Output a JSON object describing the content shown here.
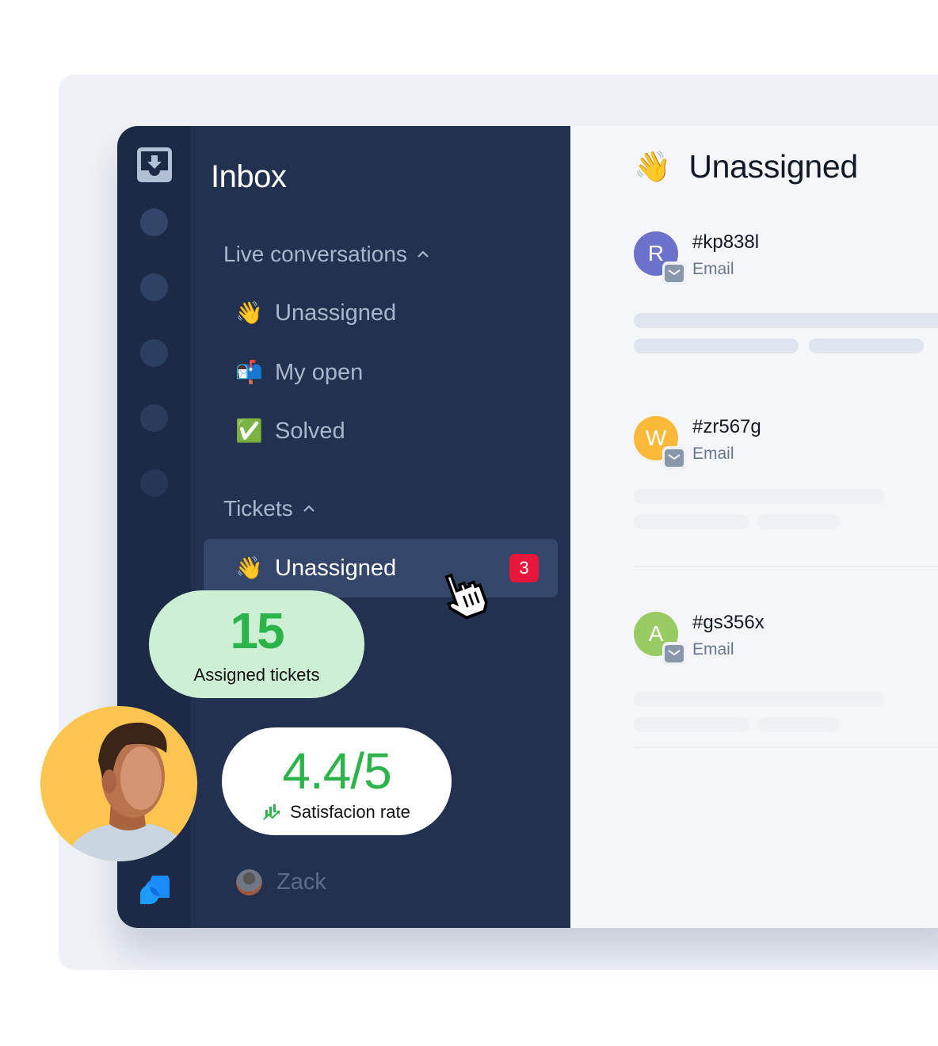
{
  "colors": {
    "rail_bg": "#1c2a46",
    "sidebar_bg": "#22314f",
    "active_item_bg": "#34466a",
    "badge_red": "#e8163a",
    "accent_green": "#2cb34a",
    "assigned_card_bg": "#cdf0d5",
    "main_bg": "#f5f6f9"
  },
  "rail": {
    "top_icon": "inbox-download-icon",
    "bottom_icon": "chat-bubbles-logo-icon"
  },
  "sidebar": {
    "title": "Inbox",
    "sections": [
      {
        "label": "Live conversations",
        "icon": "chevron-up-icon",
        "items": [
          {
            "emoji": "👋",
            "icon": "waving-hand-icon",
            "label": "Unassigned"
          },
          {
            "emoji": "📬",
            "icon": "mailbox-icon",
            "label": "My open"
          },
          {
            "emoji": "✅",
            "icon": "check-mark-icon",
            "label": "Solved"
          }
        ]
      },
      {
        "label": "Tickets",
        "icon": "chevron-up-icon",
        "items": [
          {
            "emoji": "👋",
            "icon": "waving-hand-icon",
            "label": "Unassigned",
            "badge": "3",
            "active": true
          }
        ]
      }
    ],
    "user": {
      "name": "Zack"
    }
  },
  "main": {
    "title_emoji": "👋",
    "title": "Unassigned",
    "conversations": [
      {
        "initial": "R",
        "avatar_color": "#6b72cc",
        "id": "#kp838l",
        "channel": "Email"
      },
      {
        "initial": "W",
        "avatar_color": "#fbb93a",
        "id": "#zr567g",
        "channel": "Email"
      },
      {
        "initial": "A",
        "avatar_color": "#98cb62",
        "id": "#gs356x",
        "channel": "Email"
      }
    ]
  },
  "stats": {
    "assigned": {
      "value": "15",
      "label": "Assigned tickets"
    },
    "satisfaction": {
      "value": "4.4/5",
      "label": "Satisfacion rate",
      "icon": "trend-chart-icon"
    }
  }
}
